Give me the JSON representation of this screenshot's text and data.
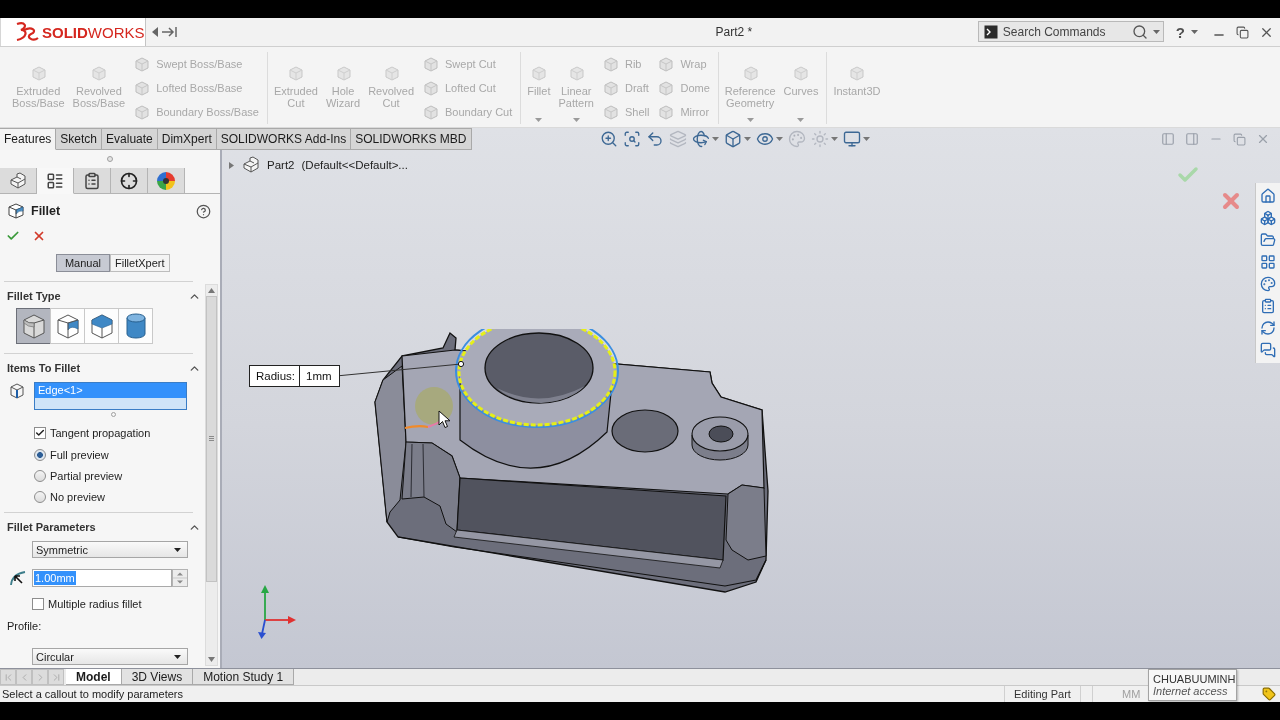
{
  "title_bar": {
    "logo": "**SOLID**WORKS",
    "title": "Part2 *",
    "search": {
      "placeholder": "Search Commands"
    },
    "help": "?"
  },
  "ribbon": [
    [
      {
        "kind": "large",
        "label": "Extruded Boss/Base",
        "disabled": true,
        "menu": false
      },
      {
        "kind": "large",
        "label": "Revolved Boss/Base",
        "disabled": true,
        "menu": false
      },
      {
        "kind": "stack",
        "items": [
          {
            "label": "Swept Boss/Base",
            "disabled": true
          },
          {
            "label": "Lofted Boss/Base",
            "disabled": true
          },
          {
            "label": "Boundary Boss/Base",
            "disabled": true
          }
        ]
      }
    ],
    [
      {
        "kind": "large",
        "label": "Extruded Cut",
        "disabled": true,
        "menu": false
      },
      {
        "kind": "large",
        "label": "Hole Wizard",
        "disabled": true,
        "menu": false
      },
      {
        "kind": "large",
        "label": "Revolved Cut",
        "disabled": true,
        "menu": false
      },
      {
        "kind": "stack",
        "items": [
          {
            "label": "Swept Cut",
            "disabled": true
          },
          {
            "label": "Lofted Cut",
            "disabled": true
          },
          {
            "label": "Boundary Cut",
            "disabled": true
          }
        ]
      }
    ],
    [
      {
        "kind": "large",
        "label": "Fillet",
        "disabled": true,
        "menu": true
      },
      {
        "kind": "large",
        "label": "Linear Pattern",
        "disabled": true,
        "menu": true
      },
      {
        "kind": "stack",
        "items": [
          {
            "label": "Rib",
            "disabled": true
          },
          {
            "label": "Draft",
            "disabled": true
          },
          {
            "label": "Shell",
            "disabled": true
          }
        ]
      },
      {
        "kind": "stack",
        "items": [
          {
            "label": "Wrap",
            "disabled": true
          },
          {
            "label": "Dome",
            "disabled": true
          },
          {
            "label": "Mirror",
            "disabled": true
          }
        ]
      }
    ],
    [
      {
        "kind": "large",
        "label": "Reference Geometry",
        "disabled": true,
        "menu": true
      },
      {
        "kind": "large",
        "label": "Curves",
        "disabled": true,
        "menu": true
      }
    ],
    [
      {
        "kind": "large",
        "label": "Instant3D",
        "disabled": true,
        "menu": false
      }
    ]
  ],
  "command_tabs": [
    {
      "label": "Features",
      "selected": true
    },
    {
      "label": "Sketch",
      "selected": false
    },
    {
      "label": "Evaluate",
      "selected": false
    },
    {
      "label": "DimXpert",
      "selected": false
    },
    {
      "label": "SOLIDWORKS Add-Ins",
      "selected": false
    },
    {
      "label": "SOLIDWORKS MBD",
      "selected": false
    }
  ],
  "view_toolbar": [
    {
      "kind": "zoom-fit",
      "disabled": false,
      "menu": false
    },
    {
      "kind": "zoom-area",
      "disabled": false,
      "menu": false
    },
    {
      "kind": "previous-view",
      "disabled": false,
      "menu": false
    },
    {
      "kind": "section-view",
      "disabled": true,
      "menu": false
    },
    {
      "kind": "view-orientation",
      "disabled": false,
      "menu": true
    },
    {
      "kind": "display-style",
      "disabled": false,
      "menu": true
    },
    {
      "kind": "hide-show",
      "disabled": false,
      "menu": true
    },
    {
      "kind": "edit-appearance",
      "disabled": true,
      "menu": false
    },
    {
      "kind": "apply-scene",
      "disabled": true,
      "menu": true
    },
    {
      "kind": "view-settings",
      "disabled": false,
      "menu": true
    }
  ],
  "property_tabs": [
    {
      "kind": "feature-tree",
      "selected": false
    },
    {
      "kind": "property-manager",
      "selected": true
    },
    {
      "kind": "configuration",
      "selected": false
    },
    {
      "kind": "dimxpert",
      "selected": false
    },
    {
      "kind": "display",
      "selected": false
    }
  ],
  "property_manager": {
    "title": "Fillet",
    "mode_tabs": [
      {
        "label": "Manual",
        "selected": true
      },
      {
        "label": "FilletXpert",
        "selected": false
      }
    ],
    "fillet_type": {
      "title": "Fillet Type",
      "expanded": true,
      "options": [
        {
          "kind": "constant",
          "selected": true
        },
        {
          "kind": "variable",
          "selected": false
        },
        {
          "kind": "face",
          "selected": false
        },
        {
          "kind": "full-round",
          "selected": false
        }
      ]
    },
    "items_to_fillet": {
      "title": "Items To Fillet",
      "expanded": true,
      "items": [
        {
          "label": "Edge<1>",
          "selected": true
        }
      ],
      "tangent_propagation": {
        "label": "Tangent propagation",
        "checked": true
      },
      "preview": [
        {
          "label": "Full preview",
          "selected": true
        },
        {
          "label": "Partial preview",
          "selected": false
        },
        {
          "label": "No preview",
          "selected": false
        }
      ]
    },
    "fillet_parameters": {
      "title": "Fillet Parameters",
      "expanded": true,
      "method": "Symmetric",
      "radius": {
        "value": "1.00mm",
        "highlighted": true
      },
      "multiple_radius": {
        "label": "Multiple radius fillet",
        "checked": false
      },
      "profile_label": "Profile:",
      "profile": "Circular"
    }
  },
  "viewport": {
    "breadcrumb": {
      "name": "Part2",
      "configuration": "(Default<<Default>..."
    },
    "callout": {
      "label": "Radius:",
      "value": "1mm"
    }
  },
  "model_tabs": [
    {
      "label": "Model",
      "selected": true
    },
    {
      "label": "3D Views",
      "selected": false
    },
    {
      "label": "Motion Study 1",
      "selected": false
    }
  ],
  "status_bar": {
    "message": "Select a callout to modify parameters",
    "mode": "Editing Part",
    "units": "MM"
  },
  "tooltip": {
    "title": "CHUABUUMINH",
    "subtitle": "Internet access"
  }
}
